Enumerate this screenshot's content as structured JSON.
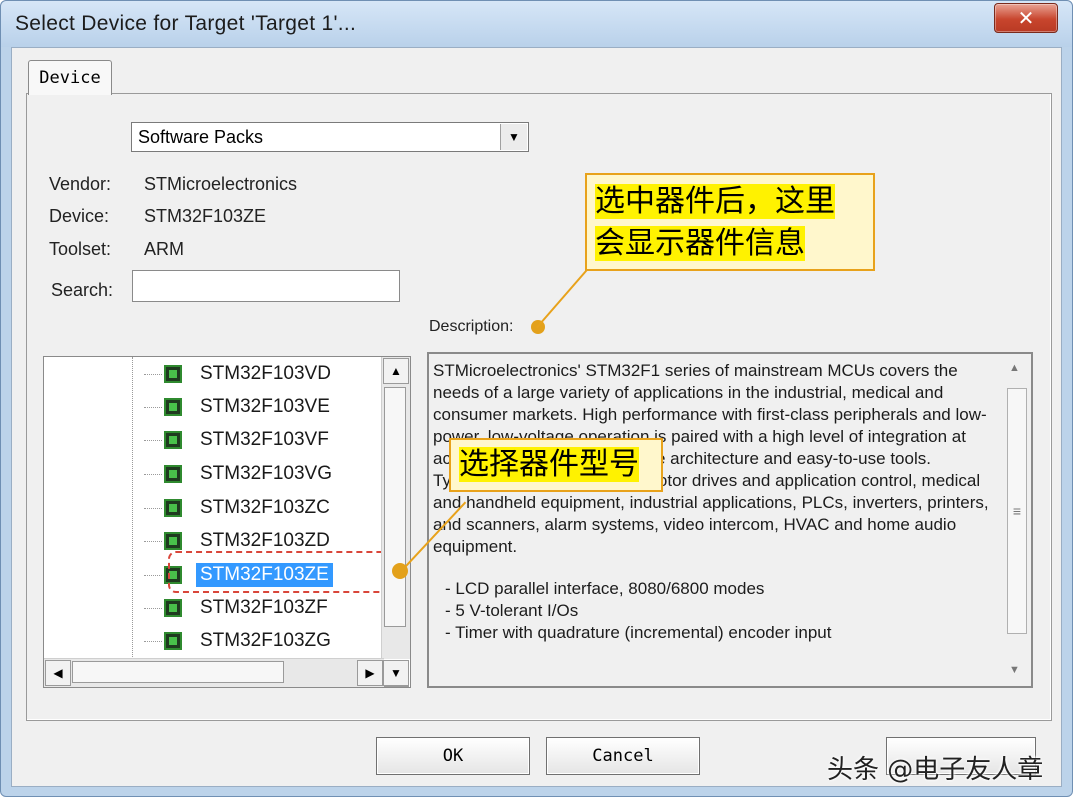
{
  "window": {
    "title": "Select Device for Target 'Target 1'...",
    "close_glyph": "✕"
  },
  "tab": {
    "label": "Device"
  },
  "pack_selector": {
    "value": "Software Packs",
    "arrow": "▼"
  },
  "fields": {
    "vendor_label": "Vendor:",
    "vendor_value": "STMicroelectronics",
    "device_label": "Device:",
    "device_value": "STM32F103ZE",
    "toolset_label": "Toolset:",
    "toolset_value": "ARM",
    "search_label": "Search:",
    "search_value": ""
  },
  "description": {
    "label": "Description:",
    "paragraphs": [
      "STMicroelectronics' STM32F1 series of mainstream MCUs covers the needs of a large variety of applications in the industrial, medical and consumer markets. High performance with first-class peripherals and low-power, low-voltage operation is paired with a high level of integration at accessible prices with a simple architecture and easy-to-use tools.",
      "Typical applications include motor drives and application control, medical and handheld equipment, industrial applications, PLCs, inverters, printers, and scanners, alarm systems, video intercom, HVAC and home audio equipment."
    ],
    "bullets": [
      "- LCD parallel interface, 8080/6800 modes",
      "- 5 V-tolerant I/Os",
      "- Timer with quadrature (incremental) encoder input"
    ]
  },
  "device_list": {
    "items": [
      "STM32F103VD",
      "STM32F103VE",
      "STM32F103VF",
      "STM32F103VG",
      "STM32F103ZC",
      "STM32F103ZD",
      "STM32F103ZE",
      "STM32F103ZF",
      "STM32F103ZG"
    ],
    "selected": "STM32F103ZE"
  },
  "scroll_glyphs": {
    "up": "▲",
    "down": "▼",
    "left": "◀",
    "right": "▶",
    "grip": "≡"
  },
  "annotations": {
    "description_callout_line1": "选中器件后，这里",
    "description_callout_line2": "会显示器件信息",
    "device_callout": "选择器件型号"
  },
  "buttons": {
    "ok": "OK",
    "cancel": "Cancel"
  },
  "watermark": "头条 @电子友人章"
}
